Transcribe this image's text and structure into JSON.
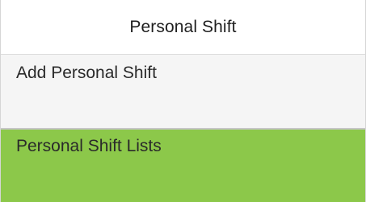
{
  "header": {
    "title": "Personal Shift"
  },
  "menu": {
    "items": [
      {
        "label": "Add Personal Shift",
        "selected": false
      },
      {
        "label": "Personal Shift Lists",
        "selected": true
      }
    ]
  },
  "colors": {
    "selected_background": "#8cc84a",
    "item_background": "#f5f5f5",
    "header_background": "#ffffff"
  }
}
